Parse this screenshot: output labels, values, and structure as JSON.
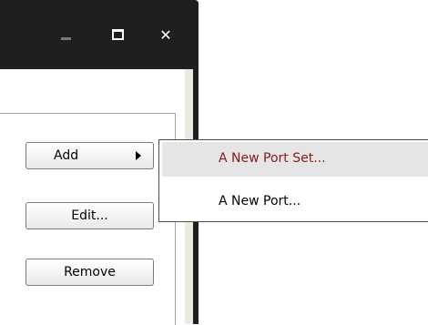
{
  "titlebar": {
    "minimize_icon": "minimize-icon",
    "maximize_icon": "maximize-icon",
    "close_icon": "close-icon",
    "close_glyph": "✕"
  },
  "buttons": {
    "add_label": "Add",
    "edit_label": "Edit...",
    "remove_label": "Remove"
  },
  "context_menu": {
    "items": [
      {
        "label": "A New Port Set...",
        "highlighted": true
      },
      {
        "label": "A New Port...",
        "highlighted": false
      }
    ]
  },
  "colors": {
    "titlebar": "#1f1f1f",
    "highlight_bg": "#e5e5e5",
    "highlight_text": "#8b1a1a"
  }
}
